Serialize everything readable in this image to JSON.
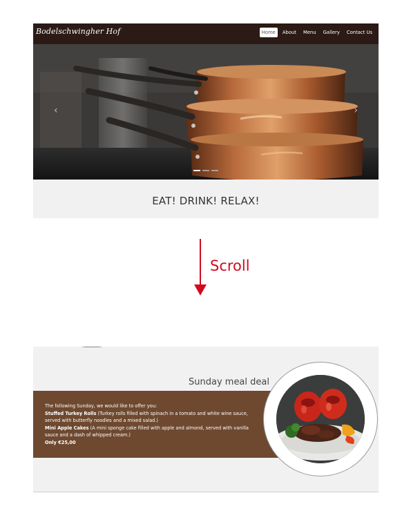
{
  "site": {
    "logo": "Bodelschwingher Hof"
  },
  "nav": {
    "items": [
      {
        "label": "Home",
        "active": true
      },
      {
        "label": "About"
      },
      {
        "label": "Menu"
      },
      {
        "label": "Gallery"
      },
      {
        "label": "Contact Us"
      }
    ]
  },
  "carousel": {
    "prev": "‹",
    "next": "›",
    "slide_count": 3,
    "active_slide": 1
  },
  "hero": {
    "tagline": "EAT! DRINK! RELAX!"
  },
  "annotation": {
    "scroll_label": "Scroll",
    "color": "#d10a1e"
  },
  "meal": {
    "title": "Sunday meal deal",
    "intro": "The following Sunday, we would like to offer you:",
    "dish1_name": "Stuffed Turkey Rolls",
    "dish1_desc": " (Turkey rolls filled with spinach in a tomato and white wine sauce, served with butterfly noodles and a mixed salad.)",
    "dish2_name": "Mini Apple Cakes",
    "dish2_desc": " (A mini sponge cake filled with apple and almond, served with vanilla sauce and a dash of whipped cream.)",
    "price": "Only €25,00"
  },
  "colors": {
    "navbar": "#2b1a15",
    "panel": "#6e4930",
    "section_bg": "#f1f1f1"
  }
}
